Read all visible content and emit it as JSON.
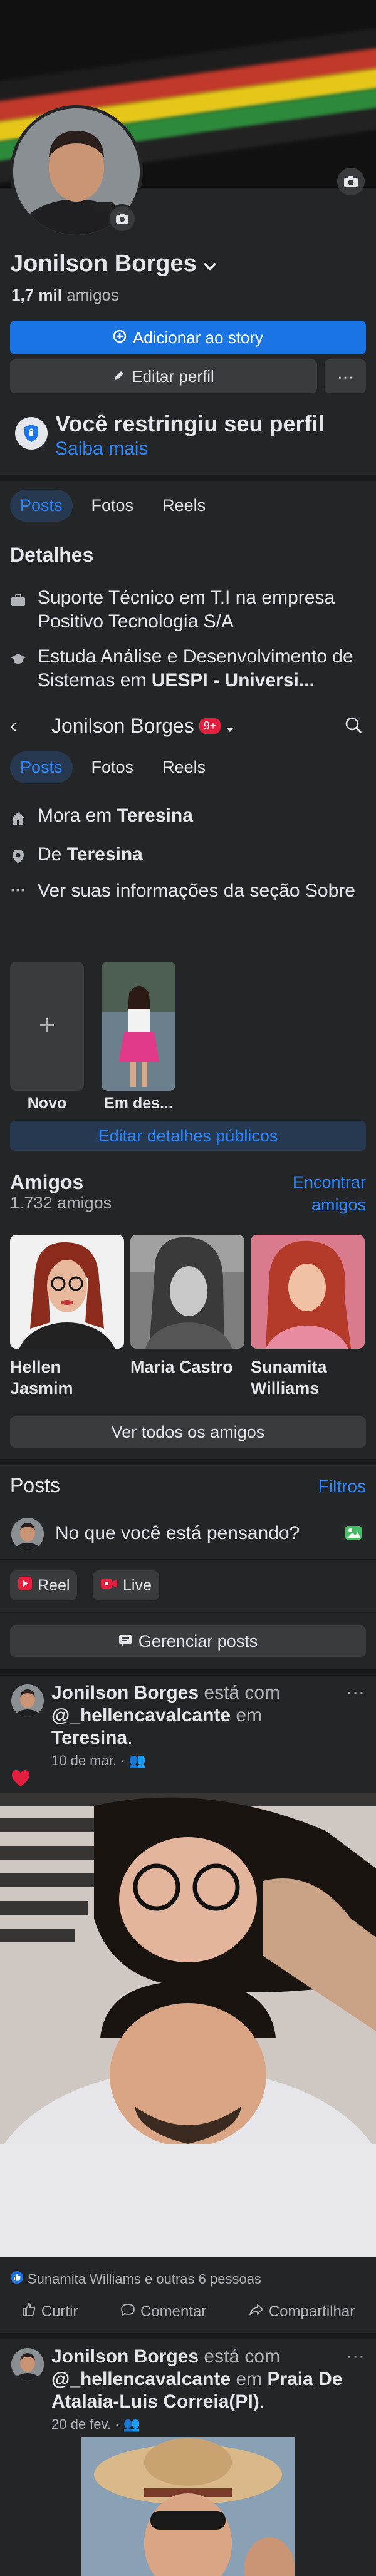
{
  "profile": {
    "name": "Jonilson Borges",
    "friends_count": "1,7 mil",
    "friends_label": "amigos"
  },
  "actions": {
    "add_story": "Adicionar ao story",
    "edit_profile": "Editar perfil",
    "more": "···"
  },
  "restriction": {
    "title": "Você restringiu seu perfil",
    "link": "Saiba mais"
  },
  "tabs": [
    "Posts",
    "Fotos",
    "Reels"
  ],
  "details": {
    "heading": "Detalhes",
    "work": "Suporte Técnico em T.I na empresa Positivo Tecnologia S/A",
    "study_prefix": "Estuda Análise e Desenvolvimento de Sistemas em ",
    "study_place": "UESPI - Universi...",
    "lives_prefix": "Mora em ",
    "lives_city": "Teresina",
    "from_prefix": "De ",
    "from_city": "Teresina",
    "about": "Ver suas informações da seção Sobre"
  },
  "sticky_header": {
    "back": "‹",
    "name": "Jonilson Borges",
    "badge": "9+"
  },
  "featured": {
    "new_label": "Novo",
    "highlight_label": "Em des...",
    "edit_public": "Editar detalhes públicos"
  },
  "friends": {
    "heading": "Amigos",
    "count": "1.732 amigos",
    "find": "Encontrar amigos",
    "list": [
      {
        "name": "Hellen Jasmim"
      },
      {
        "name": "Maria Castro"
      },
      {
        "name": "Sunamita Williams"
      }
    ],
    "see_all": "Ver todos os amigos"
  },
  "posts_section": {
    "heading": "Posts",
    "filters": "Filtros",
    "composer_placeholder": "No que você está pensando?",
    "reel": "Reel",
    "live": "Live",
    "manage": "Gerenciar posts"
  },
  "posts": [
    {
      "author": "Jonilson Borges",
      "with_text": " está com ",
      "tagged": "@_hellencavalcante",
      "in_text": " em ",
      "place": "Teresina",
      "end": ".",
      "date": "10 de mar.",
      "reactions": "Sunamita Williams e outras 6 pessoas",
      "like": "Curtir",
      "comment": "Comentar",
      "share": "Compartilhar"
    },
    {
      "author": "Jonilson Borges",
      "with_text": " está com ",
      "tagged": "@_hellencavalcante",
      "in_text": " em ",
      "place": "Praia De Atalaia-Luis Correia(PI)",
      "end": ".",
      "date": "20 de fev."
    }
  ],
  "colors": {
    "background": "#242526",
    "accent": "#1b74e4",
    "link": "#2d88ff",
    "surface": "#3a3b3c"
  },
  "icons": [
    "camera-icon",
    "chevron-down-icon",
    "plus-circle-icon",
    "pencil-icon",
    "shield-icon",
    "briefcase-icon",
    "graduation-icon",
    "home-icon",
    "location-icon",
    "search-icon",
    "photo-icon",
    "reel-icon",
    "live-icon",
    "like-icon",
    "comment-icon",
    "share-icon"
  ]
}
